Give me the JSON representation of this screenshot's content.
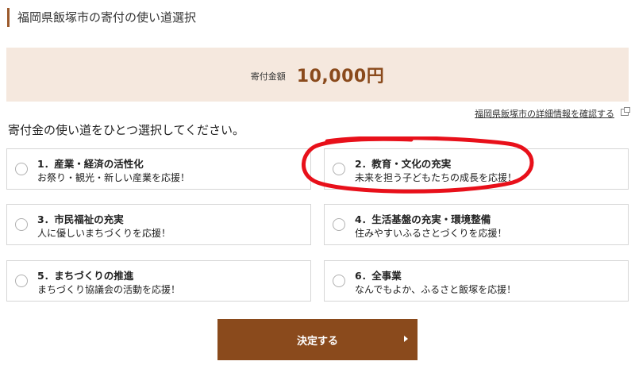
{
  "header": {
    "title": "福岡県飯塚市の寄付の使い道選択"
  },
  "donation": {
    "label": "寄付金額",
    "amount": "10,000円"
  },
  "detail_link": {
    "text": "福岡県飯塚市の詳細情報を確認する"
  },
  "instruction": "寄付金の使い道をひとつ選択してください。",
  "options": [
    {
      "title": "1．産業・経済の活性化",
      "desc": "お祭り・観光・新しい産業を応援！"
    },
    {
      "title": "2．教育・文化の充実",
      "desc": "未来を担う子どもたちの成長を応援！"
    },
    {
      "title": "3．市民福祉の充実",
      "desc": "人に優しいまちづくりを応援！"
    },
    {
      "title": "4．生活基盤の充実・環境整備",
      "desc": "住みやすいふるさとづくりを応援！"
    },
    {
      "title": "5．まちづくりの推進",
      "desc": "まちづくり協議会の活動を応援！"
    },
    {
      "title": "6．全事業",
      "desc": "なんでもよか、ふるさと飯塚を応援！"
    }
  ],
  "submit": {
    "label": "決定する"
  },
  "colors": {
    "accent": "#8a4a1c",
    "amount_bg": "#f5e8de",
    "annotation": "#e8101a"
  }
}
